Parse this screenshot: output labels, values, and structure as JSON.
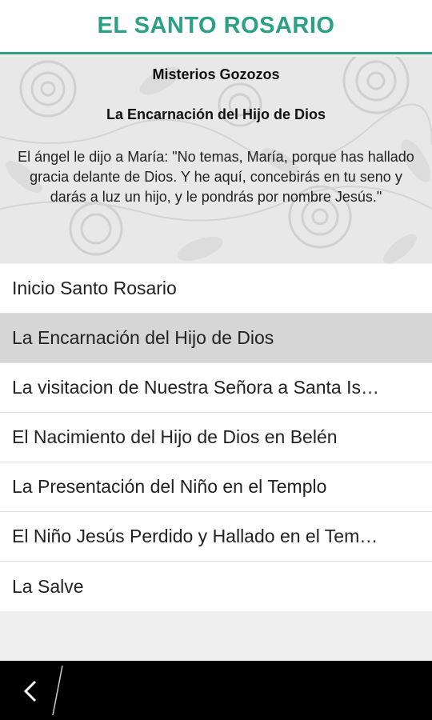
{
  "app": {
    "title": "EL SANTO ROSARIO",
    "accent_color": "#2aa184"
  },
  "hero": {
    "section_title": "Misterios Gozozos",
    "mystery_title": "La Encarnación del Hijo de Dios",
    "quote": "El ángel le dijo a María: \"No temas, María, porque has hallado gracia delante de Dios. Y he aquí, concebirás en tu seno y darás a luz un hijo, y le pondrás por nombre Jesús.\"",
    "background": "roses-pattern"
  },
  "menu": {
    "items": [
      {
        "label": "Inicio Santo Rosario",
        "selected": false
      },
      {
        "label": "La Encarnación del Hijo de Dios",
        "selected": true
      },
      {
        "label": "La visitacion de Nuestra Señora a Santa Is…",
        "selected": false
      },
      {
        "label": "El Nacimiento del Hijo de Dios en Belén",
        "selected": false
      },
      {
        "label": "La Presentación del Niño en el Templo",
        "selected": false
      },
      {
        "label": "El Niño Jesús Perdido y Hallado en el Tem…",
        "selected": false
      },
      {
        "label": "La Salve",
        "selected": false
      }
    ]
  },
  "nav": {
    "back_icon": "back-arrow-icon"
  }
}
